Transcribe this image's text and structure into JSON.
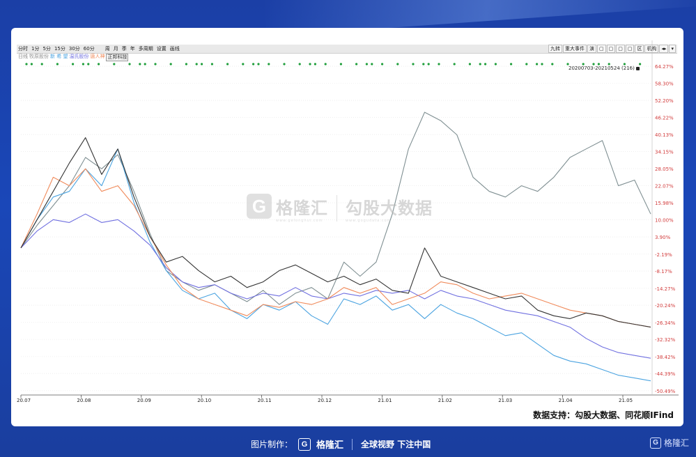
{
  "toolbar": {
    "left_items": [
      "分时",
      "1分",
      "5分",
      "15分",
      "30分",
      "60分",
      "周",
      "月",
      "季",
      "年",
      "多周期",
      "设置",
      "画线"
    ],
    "right_items": [
      "九转",
      "重大事件",
      "演",
      "▢",
      "▢",
      "▢",
      "▢",
      "区",
      "机构",
      "◂▸",
      "▾"
    ]
  },
  "legend": {
    "items": [
      {
        "label": "日线",
        "color": "#8a8a8a",
        "active": false
      },
      {
        "label": "牧原股份",
        "color": "#909090",
        "active": false
      },
      {
        "label": "新 希 望",
        "color": "#4aa3e0",
        "active": false
      },
      {
        "label": "温氏股份",
        "color": "#6f6fe0",
        "active": false
      },
      {
        "label": "唐人神",
        "color": "#f08a5a",
        "active": false
      },
      {
        "label": "正邦科技",
        "color": "#333333",
        "active": true
      }
    ]
  },
  "range_label": "20200703-20210524 (216)",
  "watermark": {
    "logo_char": "G",
    "brand": "格隆汇",
    "brand_url": "www.gelonghui.com",
    "product": "勾股大数据",
    "product_url": "www.gogudata.com"
  },
  "source": "数据支持：勾股大数据、同花顺IFind",
  "footer": {
    "made_by": "图片制作：",
    "logo_char": "G",
    "brand": "格隆汇",
    "slogan": "全球视野 下注中国",
    "corner_brand": "格隆汇"
  },
  "chart_data": {
    "type": "line",
    "x": [
      "20.07",
      "20.08",
      "20.09",
      "20.10",
      "20.11",
      "20.12",
      "21.01",
      "21.02",
      "21.03",
      "21.04",
      "21.05"
    ],
    "y_ticks": [
      "64.27%",
      "58.30%",
      "52.20%",
      "46.22%",
      "40.13%",
      "34.15%",
      "28.05%",
      "22.07%",
      "15.98%",
      "10.00%",
      "3.90%",
      "-2.19%",
      "-8.17%",
      "-14.27%",
      "-20.24%",
      "-26.34%",
      "-32.32%",
      "-38.42%",
      "-44.39%",
      "-50.49%"
    ],
    "ylim": [
      -52,
      66
    ],
    "grid": true,
    "series": [
      {
        "name": "牧原股份",
        "color": "#7f8f92",
        "values": [
          0,
          8,
          15,
          22,
          32,
          28,
          33,
          20,
          5,
          -8,
          -12,
          -15,
          -13,
          -16,
          -19,
          -15,
          -20,
          -16,
          -14,
          -18,
          -5,
          -10,
          -5,
          12,
          35,
          48,
          45,
          40,
          25,
          20,
          18,
          22,
          20,
          25,
          32,
          35,
          38,
          22,
          24,
          12
        ]
      },
      {
        "name": "新 希 望",
        "color": "#4aa3e0",
        "values": [
          0,
          10,
          18,
          20,
          28,
          22,
          35,
          16,
          2,
          -8,
          -15,
          -18,
          -16,
          -22,
          -25,
          -20,
          -22,
          -19,
          -24,
          -27,
          -18,
          -20,
          -17,
          -22,
          -20,
          -25,
          -20,
          -23,
          -25,
          -28,
          -31,
          -30,
          -34,
          -38,
          -40,
          -41,
          -43,
          -45,
          -46,
          -47
        ]
      },
      {
        "name": "温氏股份",
        "color": "#6f6fe0",
        "values": [
          0,
          6,
          10,
          9,
          12,
          9,
          10,
          6,
          1,
          -7,
          -12,
          -14,
          -13,
          -16,
          -18,
          -16,
          -17,
          -14,
          -17,
          -18,
          -16,
          -17,
          -15,
          -16,
          -15,
          -18,
          -15,
          -17,
          -18,
          -20,
          -22,
          -23,
          -24,
          -26,
          -28,
          -32,
          -35,
          -37,
          -38,
          -39
        ]
      },
      {
        "name": "唐人神",
        "color": "#f08a5a",
        "values": [
          0,
          12,
          25,
          22,
          28,
          20,
          22,
          15,
          4,
          -6,
          -14,
          -18,
          -20,
          -22,
          -24,
          -20,
          -21,
          -19,
          -20,
          -18,
          -14,
          -16,
          -14,
          -20,
          -18,
          -16,
          -12,
          -13,
          -16,
          -18,
          -17,
          -16,
          -18,
          -20,
          -22,
          -23,
          -24,
          -26,
          -27,
          -28
        ]
      },
      {
        "name": "正邦科技",
        "color": "#333333",
        "values": [
          0,
          10,
          20,
          30,
          39,
          26,
          35,
          18,
          4,
          -5,
          -3,
          -8,
          -12,
          -10,
          -14,
          -12,
          -8,
          -6,
          -9,
          -12,
          -10,
          -13,
          -11,
          -15,
          -16,
          0,
          -10,
          -12,
          -14,
          -16,
          -18,
          -17,
          -22,
          -24,
          -25,
          -23,
          -24,
          -26,
          -27,
          -28
        ]
      }
    ]
  }
}
